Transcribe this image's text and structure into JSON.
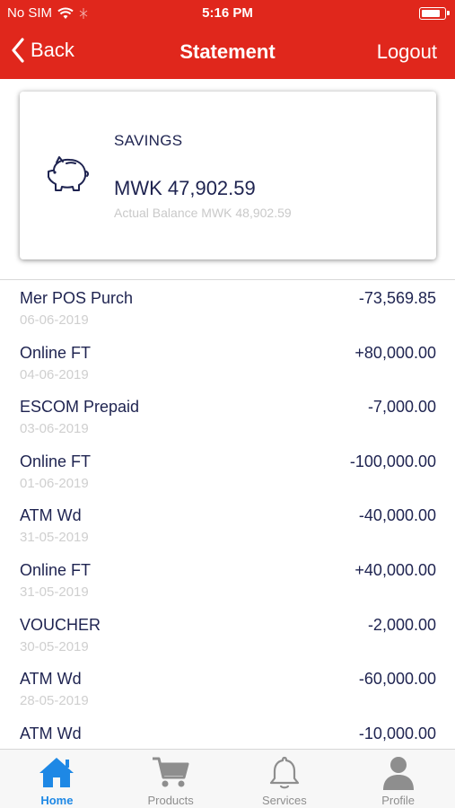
{
  "status_bar": {
    "carrier": "No SIM",
    "time": "5:16 PM"
  },
  "nav": {
    "back_label": "Back",
    "title": "Statement",
    "logout_label": "Logout"
  },
  "account": {
    "type": "SAVINGS",
    "balance": "MWK 47,902.59",
    "actual_balance": "Actual Balance MWK 48,902.59",
    "icon": "piggy-bank-icon"
  },
  "transactions": [
    {
      "description": "Mer POS Purch",
      "date": "06-06-2019",
      "amount": "-73,569.85"
    },
    {
      "description": "Online FT",
      "date": "04-06-2019",
      "amount": "+80,000.00"
    },
    {
      "description": "ESCOM Prepaid",
      "date": "03-06-2019",
      "amount": "-7,000.00"
    },
    {
      "description": "Online FT",
      "date": "01-06-2019",
      "amount": "-100,000.00"
    },
    {
      "description": "ATM Wd",
      "date": "31-05-2019",
      "amount": "-40,000.00"
    },
    {
      "description": "Online FT",
      "date": "31-05-2019",
      "amount": "+40,000.00"
    },
    {
      "description": "VOUCHER",
      "date": "30-05-2019",
      "amount": "-2,000.00"
    },
    {
      "description": "ATM Wd",
      "date": "28-05-2019",
      "amount": "-60,000.00"
    },
    {
      "description": "ATM Wd",
      "date": "",
      "amount": "-10,000.00"
    }
  ],
  "tabs": [
    {
      "label": "Home",
      "icon": "home-icon",
      "active": true
    },
    {
      "label": "Products",
      "icon": "cart-icon",
      "active": false
    },
    {
      "label": "Services",
      "icon": "bell-icon",
      "active": false
    },
    {
      "label": "Profile",
      "icon": "user-icon",
      "active": false
    }
  ],
  "colors": {
    "brand": "#e0271c",
    "text": "#1e2350",
    "active_tab": "#1e88e5",
    "muted": "#cfcfcf"
  }
}
